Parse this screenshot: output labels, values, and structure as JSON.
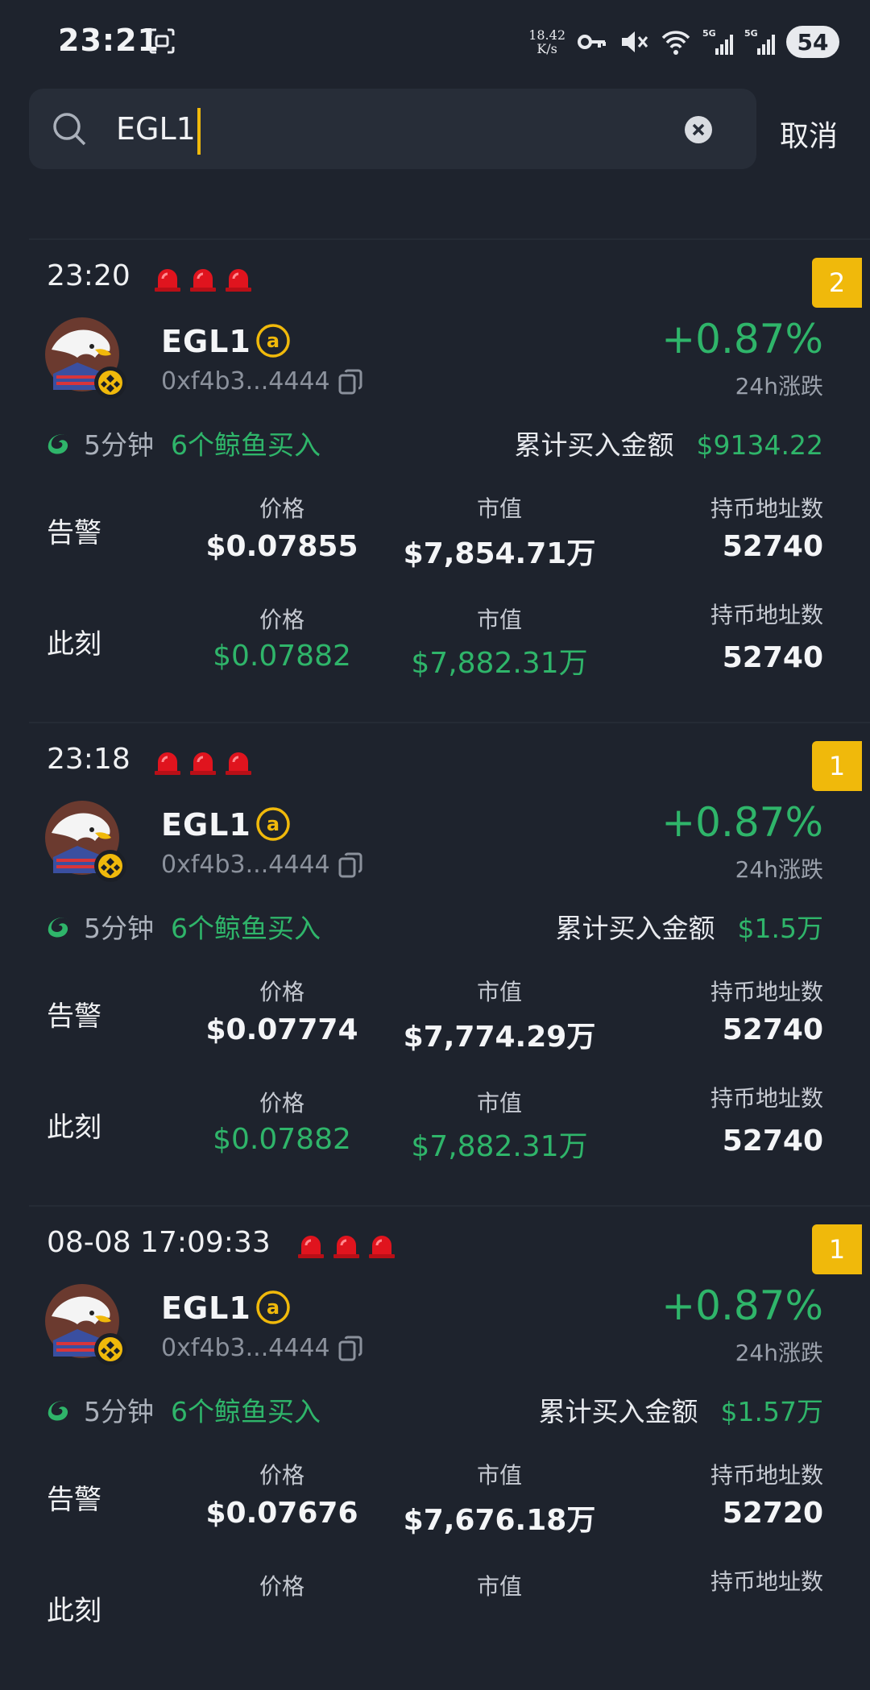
{
  "status_bar": {
    "time": "23:21",
    "speed_value": "18.42",
    "speed_unit": "K/s",
    "battery": "54"
  },
  "search": {
    "query": "EGL1",
    "cancel_label": "取消"
  },
  "columns": {
    "price": "价格",
    "mcap": "市值",
    "holders": "持币地址数"
  },
  "row_labels": {
    "alert": "告警",
    "now": "此刻"
  },
  "token": {
    "name": "EGL1",
    "address": "0xf4b3...4444",
    "change": "+0.87%",
    "change_label": "24h涨跌"
  },
  "cards": [
    {
      "time": "23:20",
      "badge": "2",
      "whale_time": "5分钟",
      "whale_count": "6个鲸鱼买入",
      "total_label": "累计买入金额",
      "total_value": "$9134.22",
      "alert": {
        "price": "$0.07855",
        "mcap": "$7,854.71万",
        "holders": "52740"
      },
      "now": {
        "price": "$0.07882",
        "mcap": "$7,882.31万",
        "holders": "52740"
      }
    },
    {
      "time": "23:18",
      "badge": "1",
      "whale_time": "5分钟",
      "whale_count": "6个鲸鱼买入",
      "total_label": "累计买入金额",
      "total_value": "$1.5万",
      "alert": {
        "price": "$0.07774",
        "mcap": "$7,774.29万",
        "holders": "52740"
      },
      "now": {
        "price": "$0.07882",
        "mcap": "$7,882.31万",
        "holders": "52740"
      }
    },
    {
      "time": "08-08 17:09:33",
      "badge": "1",
      "whale_time": "5分钟",
      "whale_count": "6个鲸鱼买入",
      "total_label": "累计买入金额",
      "total_value": "$1.57万",
      "alert": {
        "price": "$0.07676",
        "mcap": "$7,676.18万",
        "holders": "52720"
      },
      "now": {
        "price": "",
        "mcap": "",
        "holders": ""
      }
    }
  ],
  "colors": {
    "green": "#2fb56a",
    "badge": "#f0b90b",
    "background": "#1e232d",
    "siren": "#e0141e"
  },
  "icons": [
    "screenshot-icon",
    "key-icon",
    "mute-icon",
    "wifi-icon",
    "signal-5g-icon",
    "search-icon",
    "clear-icon",
    "siren-icon",
    "eagle-avatar",
    "bnb-chain-icon",
    "at-icon",
    "copy-icon",
    "whale-icon"
  ]
}
